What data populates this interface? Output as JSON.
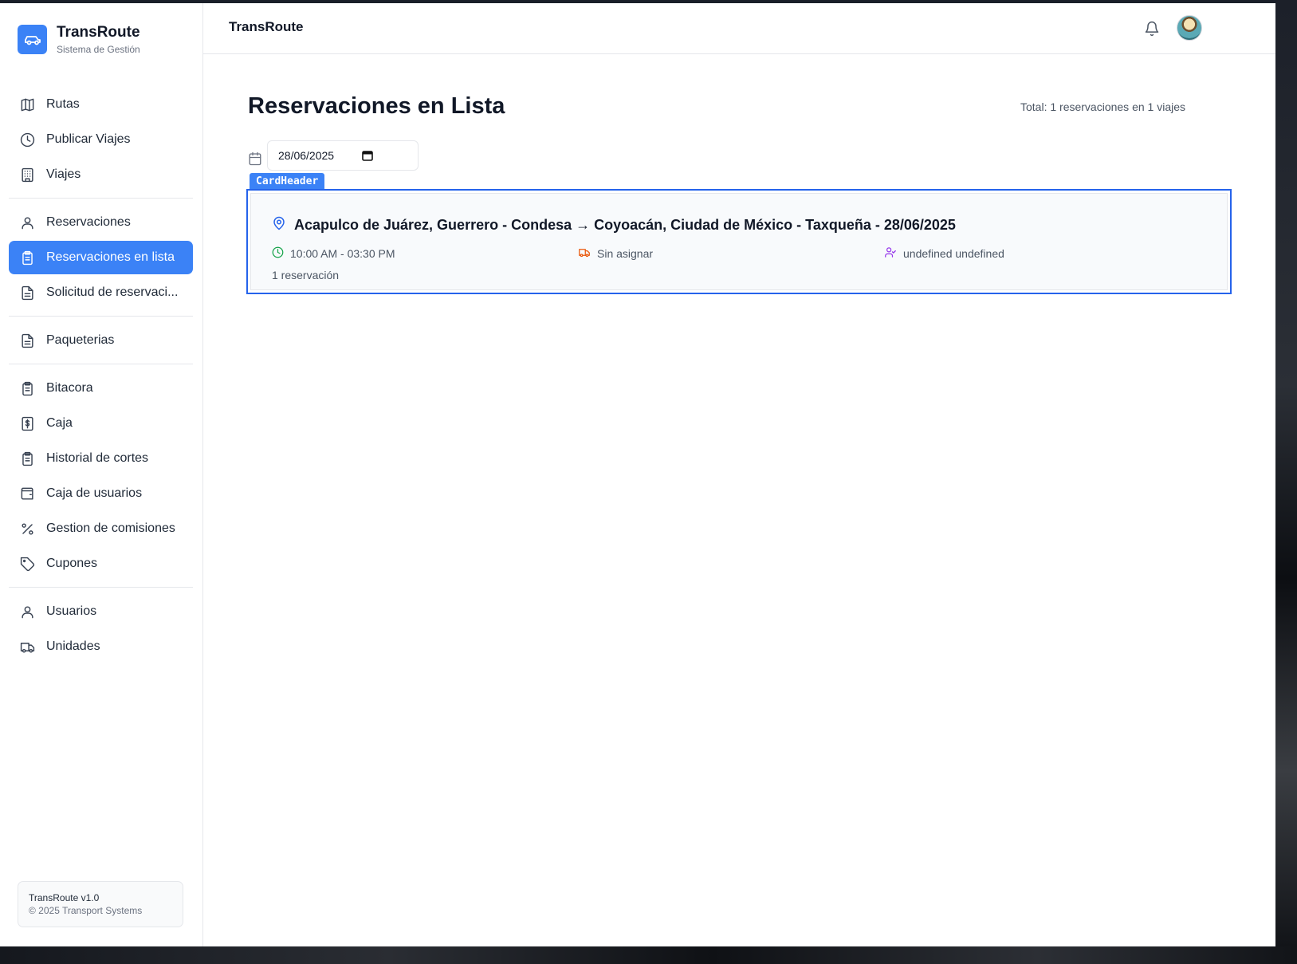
{
  "brand": {
    "title": "TransRoute",
    "subtitle": "Sistema de Gestión"
  },
  "sidebar": {
    "groups": [
      [
        {
          "label": "Rutas",
          "icon": "map-icon"
        },
        {
          "label": "Publicar Viajes",
          "icon": "clock-icon"
        },
        {
          "label": "Viajes",
          "icon": "building-icon"
        }
      ],
      [
        {
          "label": "Reservaciones",
          "icon": "user-icon"
        },
        {
          "label": "Reservaciones en lista",
          "icon": "clipboard-icon",
          "active": true
        },
        {
          "label": "Solicitud de reservaci...",
          "icon": "document-icon"
        }
      ],
      [
        {
          "label": "Paqueterias",
          "icon": "document-icon"
        }
      ],
      [
        {
          "label": "Bitacora",
          "icon": "clipboard-icon"
        },
        {
          "label": "Caja",
          "icon": "dollar-receipt-icon"
        },
        {
          "label": "Historial de cortes",
          "icon": "clipboard-icon"
        },
        {
          "label": "Caja de usuarios",
          "icon": "wallet-icon"
        },
        {
          "label": "Gestion de comisiones",
          "icon": "percent-icon"
        },
        {
          "label": "Cupones",
          "icon": "tag-icon"
        }
      ],
      [
        {
          "label": "Usuarios",
          "icon": "user-icon"
        },
        {
          "label": "Unidades",
          "icon": "truck-icon"
        }
      ]
    ],
    "version": "TransRoute v1.0",
    "copyright": "© 2025 Transport Systems"
  },
  "header": {
    "title": "TransRoute"
  },
  "main": {
    "title": "Reservaciones en Lista",
    "total": "Total: 1 reservaciones en 1 viajes",
    "date_value": "28/06/2025",
    "debug_tag": "CardHeader",
    "trip": {
      "route": "Acapulco de Juárez, Guerrero - Condesa → Coyoacán, Ciudad de México - Taxqueña - 28/06/2025",
      "time": "10:00 AM - 03:30 PM",
      "vehicle": "Sin asignar",
      "driver": "undefined undefined",
      "count": "1 reservación"
    }
  },
  "colors": {
    "accent": "#3b82f6",
    "time_icon": "#16a34a",
    "vehicle_icon": "#ea580c",
    "driver_icon": "#9333ea",
    "route_icon": "#2563eb"
  }
}
